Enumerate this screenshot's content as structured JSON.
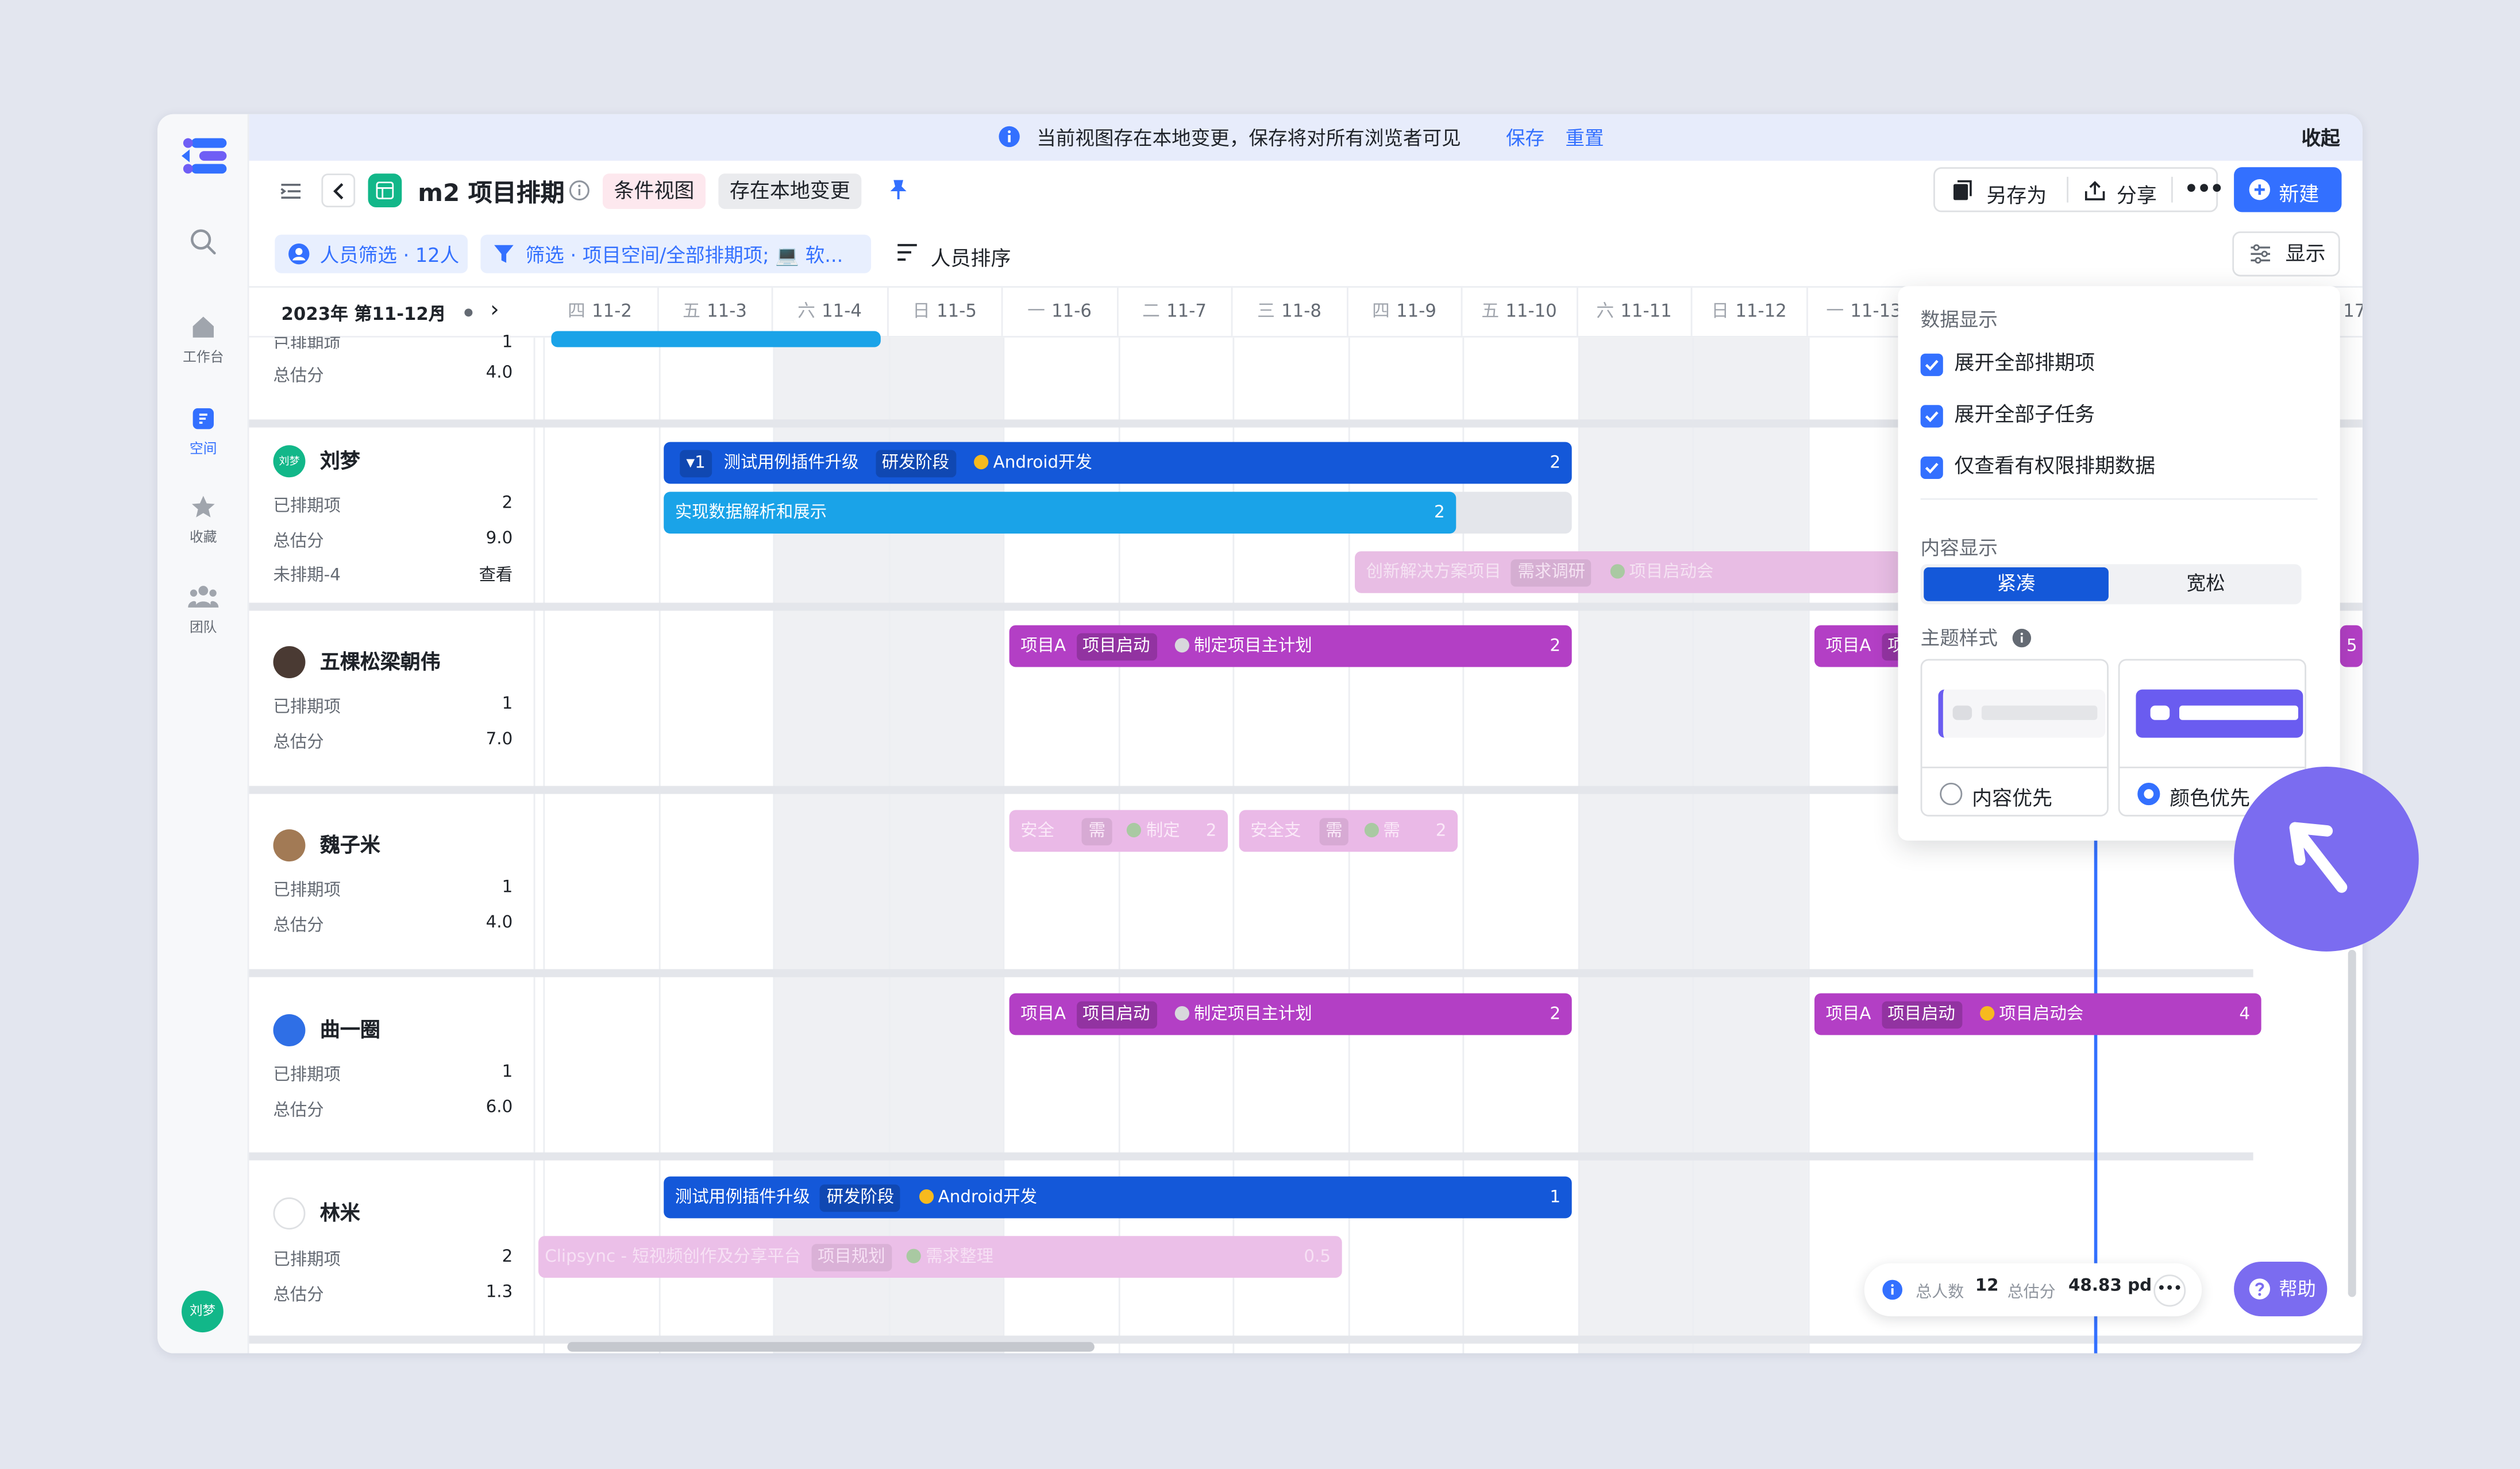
{
  "banner": {
    "message": "当前视图存在本地变更，保存将对所有浏览者可见",
    "save": "保存",
    "reset": "重置",
    "collapse": "收起"
  },
  "sidebar": {
    "items": [
      {
        "label": "工作台",
        "icon": "home-icon"
      },
      {
        "label": "空间",
        "icon": "space-icon"
      },
      {
        "label": "收藏",
        "icon": "star-icon"
      },
      {
        "label": "团队",
        "icon": "team-icon"
      }
    ],
    "avatar": "刘梦"
  },
  "toolbar": {
    "title": "m2 项目排期",
    "tag_condition": "条件视图",
    "tag_local": "存在本地变更",
    "save_as": "另存为",
    "share": "分享",
    "new": "新建",
    "display": "显示"
  },
  "filters": {
    "people": "人员筛选 · 12人",
    "filter": "筛选 · 项目空间/全部排期项; 💻 软...",
    "sort": "人员排序"
  },
  "calendar": {
    "period": "2023年 第11-12月",
    "days": [
      {
        "wd": "四",
        "d": "11-2"
      },
      {
        "wd": "五",
        "d": "11-3"
      },
      {
        "wd": "六",
        "d": "11-4"
      },
      {
        "wd": "日",
        "d": "11-5"
      },
      {
        "wd": "一",
        "d": "11-6"
      },
      {
        "wd": "二",
        "d": "11-7"
      },
      {
        "wd": "三",
        "d": "11-8"
      },
      {
        "wd": "四",
        "d": "11-9"
      },
      {
        "wd": "五",
        "d": "11-10"
      },
      {
        "wd": "六",
        "d": "11-11"
      },
      {
        "wd": "日",
        "d": "11-12"
      },
      {
        "wd": "一",
        "d": "11-13"
      }
    ],
    "last_day": "17"
  },
  "people": [
    {
      "name": "",
      "stats": [
        {
          "label": "已排期项",
          "value": "1"
        },
        {
          "label": "总估分",
          "value": "4.0"
        }
      ]
    },
    {
      "name": "刘梦",
      "stats": [
        {
          "label": "已排期项",
          "value": "2"
        },
        {
          "label": "总估分",
          "value": "9.0"
        },
        {
          "label": "未排期-4",
          "value": "查看"
        }
      ]
    },
    {
      "name": "五棵松梁朝伟",
      "stats": [
        {
          "label": "已排期项",
          "value": "1"
        },
        {
          "label": "总估分",
          "value": "7.0"
        }
      ]
    },
    {
      "name": "魏子米",
      "stats": [
        {
          "label": "已排期项",
          "value": "1"
        },
        {
          "label": "总估分",
          "value": "4.0"
        }
      ]
    },
    {
      "name": "曲一圈",
      "stats": [
        {
          "label": "已排期项",
          "value": "1"
        },
        {
          "label": "总估分",
          "value": "6.0"
        }
      ]
    },
    {
      "name": "林米",
      "stats": [
        {
          "label": "已排期项",
          "value": "2"
        },
        {
          "label": "总估分",
          "value": "1.3"
        }
      ]
    }
  ],
  "bars": {
    "liu1": {
      "prefix": "▾1",
      "title": "测试用例插件升级",
      "stage": "研发阶段",
      "task": "Android开发",
      "count": "2"
    },
    "liu2": {
      "title": "实现数据解析和展示",
      "count": "2"
    },
    "liu3": {
      "title": "创新解决方案项目",
      "stage": "需求调研",
      "task": "项目启动会"
    },
    "wu1": {
      "title": "项目A",
      "stage": "项目启动",
      "task": "制定项目主计划",
      "count": "2"
    },
    "wu2": {
      "title": "项目A",
      "stage": "项目启",
      "count": "5"
    },
    "wei1": {
      "title": "安全",
      "stage": "需",
      "task": "制定",
      "count": "2"
    },
    "wei2": {
      "title": "安全支",
      "stage": "需",
      "task": "需",
      "count": "2"
    },
    "qu1": {
      "title": "项目A",
      "stage": "项目启动",
      "task": "制定项目主计划",
      "count": "2"
    },
    "qu2": {
      "title": "项目A",
      "stage": "项目启动",
      "task": "项目启动会",
      "count": "4"
    },
    "lin1": {
      "title": "测试用例插件升级",
      "stage": "研发阶段",
      "task": "Android开发",
      "count": "1"
    },
    "lin2": {
      "title": "Clipsync - 短视频创作及分享平台",
      "stage": "项目规划",
      "task": "需求整理",
      "count": "0.5"
    }
  },
  "panel": {
    "data_section": "数据显示",
    "options": [
      "展开全部排期项",
      "展开全部子任务",
      "仅查看有权限排期数据"
    ],
    "content_section": "内容显示",
    "compact": "紧凑",
    "loose": "宽松",
    "theme_section": "主题样式",
    "theme_content": "内容优先",
    "theme_color": "颜色优先"
  },
  "summary": {
    "people_label": "总人数",
    "people": "12",
    "score_label": "总估分",
    "score": "48.83 pd"
  },
  "help": "帮助",
  "colors": {
    "accent": "#3370ff",
    "bar_blue": "#1458d9",
    "bar_cyan": "#1aa3e8",
    "bar_purple": "#b33fc5",
    "dot_yellow": "#f7ba1e",
    "dot_grey": "#c7cbd1",
    "cursor_circle": "#7b6cf0"
  }
}
